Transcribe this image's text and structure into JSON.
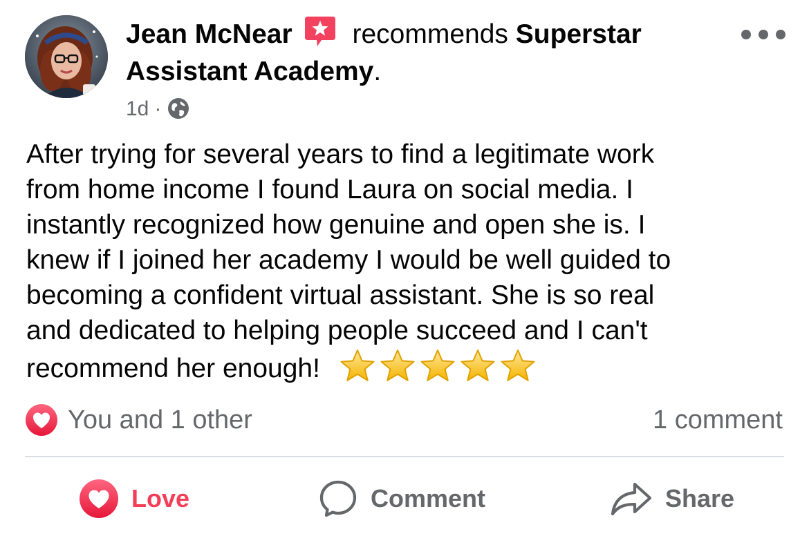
{
  "post": {
    "author": "Jean McNear",
    "action_text": "recommends",
    "page_name_part1": "Superstar",
    "page_name_part2": "Assistant Academy",
    "period": ".",
    "time": "1d",
    "separator": "·",
    "privacy_icon": "globe-icon",
    "recommend_badge_icon": "recommend-star-icon",
    "more_icon": "more-options-icon",
    "text_lines": [
      "After trying for several years to find a legitimate work",
      "from home income I found Laura on social media. I",
      "instantly recognized how genuine and open she is. I",
      "knew if I joined her academy I would be well guided to",
      "becoming a confident virtual assistant. She is so real",
      "and dedicated to helping people succeed and I can't",
      "recommend her enough!"
    ],
    "star_rating": 5,
    "star_icon": "star-emoji"
  },
  "reactions": {
    "summary": "You and 1 other",
    "icon": "love-reaction-icon",
    "comment_count": "1 comment"
  },
  "actions": {
    "love_label": "Love",
    "comment_label": "Comment",
    "share_label": "Share"
  },
  "colors": {
    "love": "#f33e58",
    "secondary_text": "#65676b",
    "divider": "#dadde1",
    "badge": "#f3425f"
  }
}
